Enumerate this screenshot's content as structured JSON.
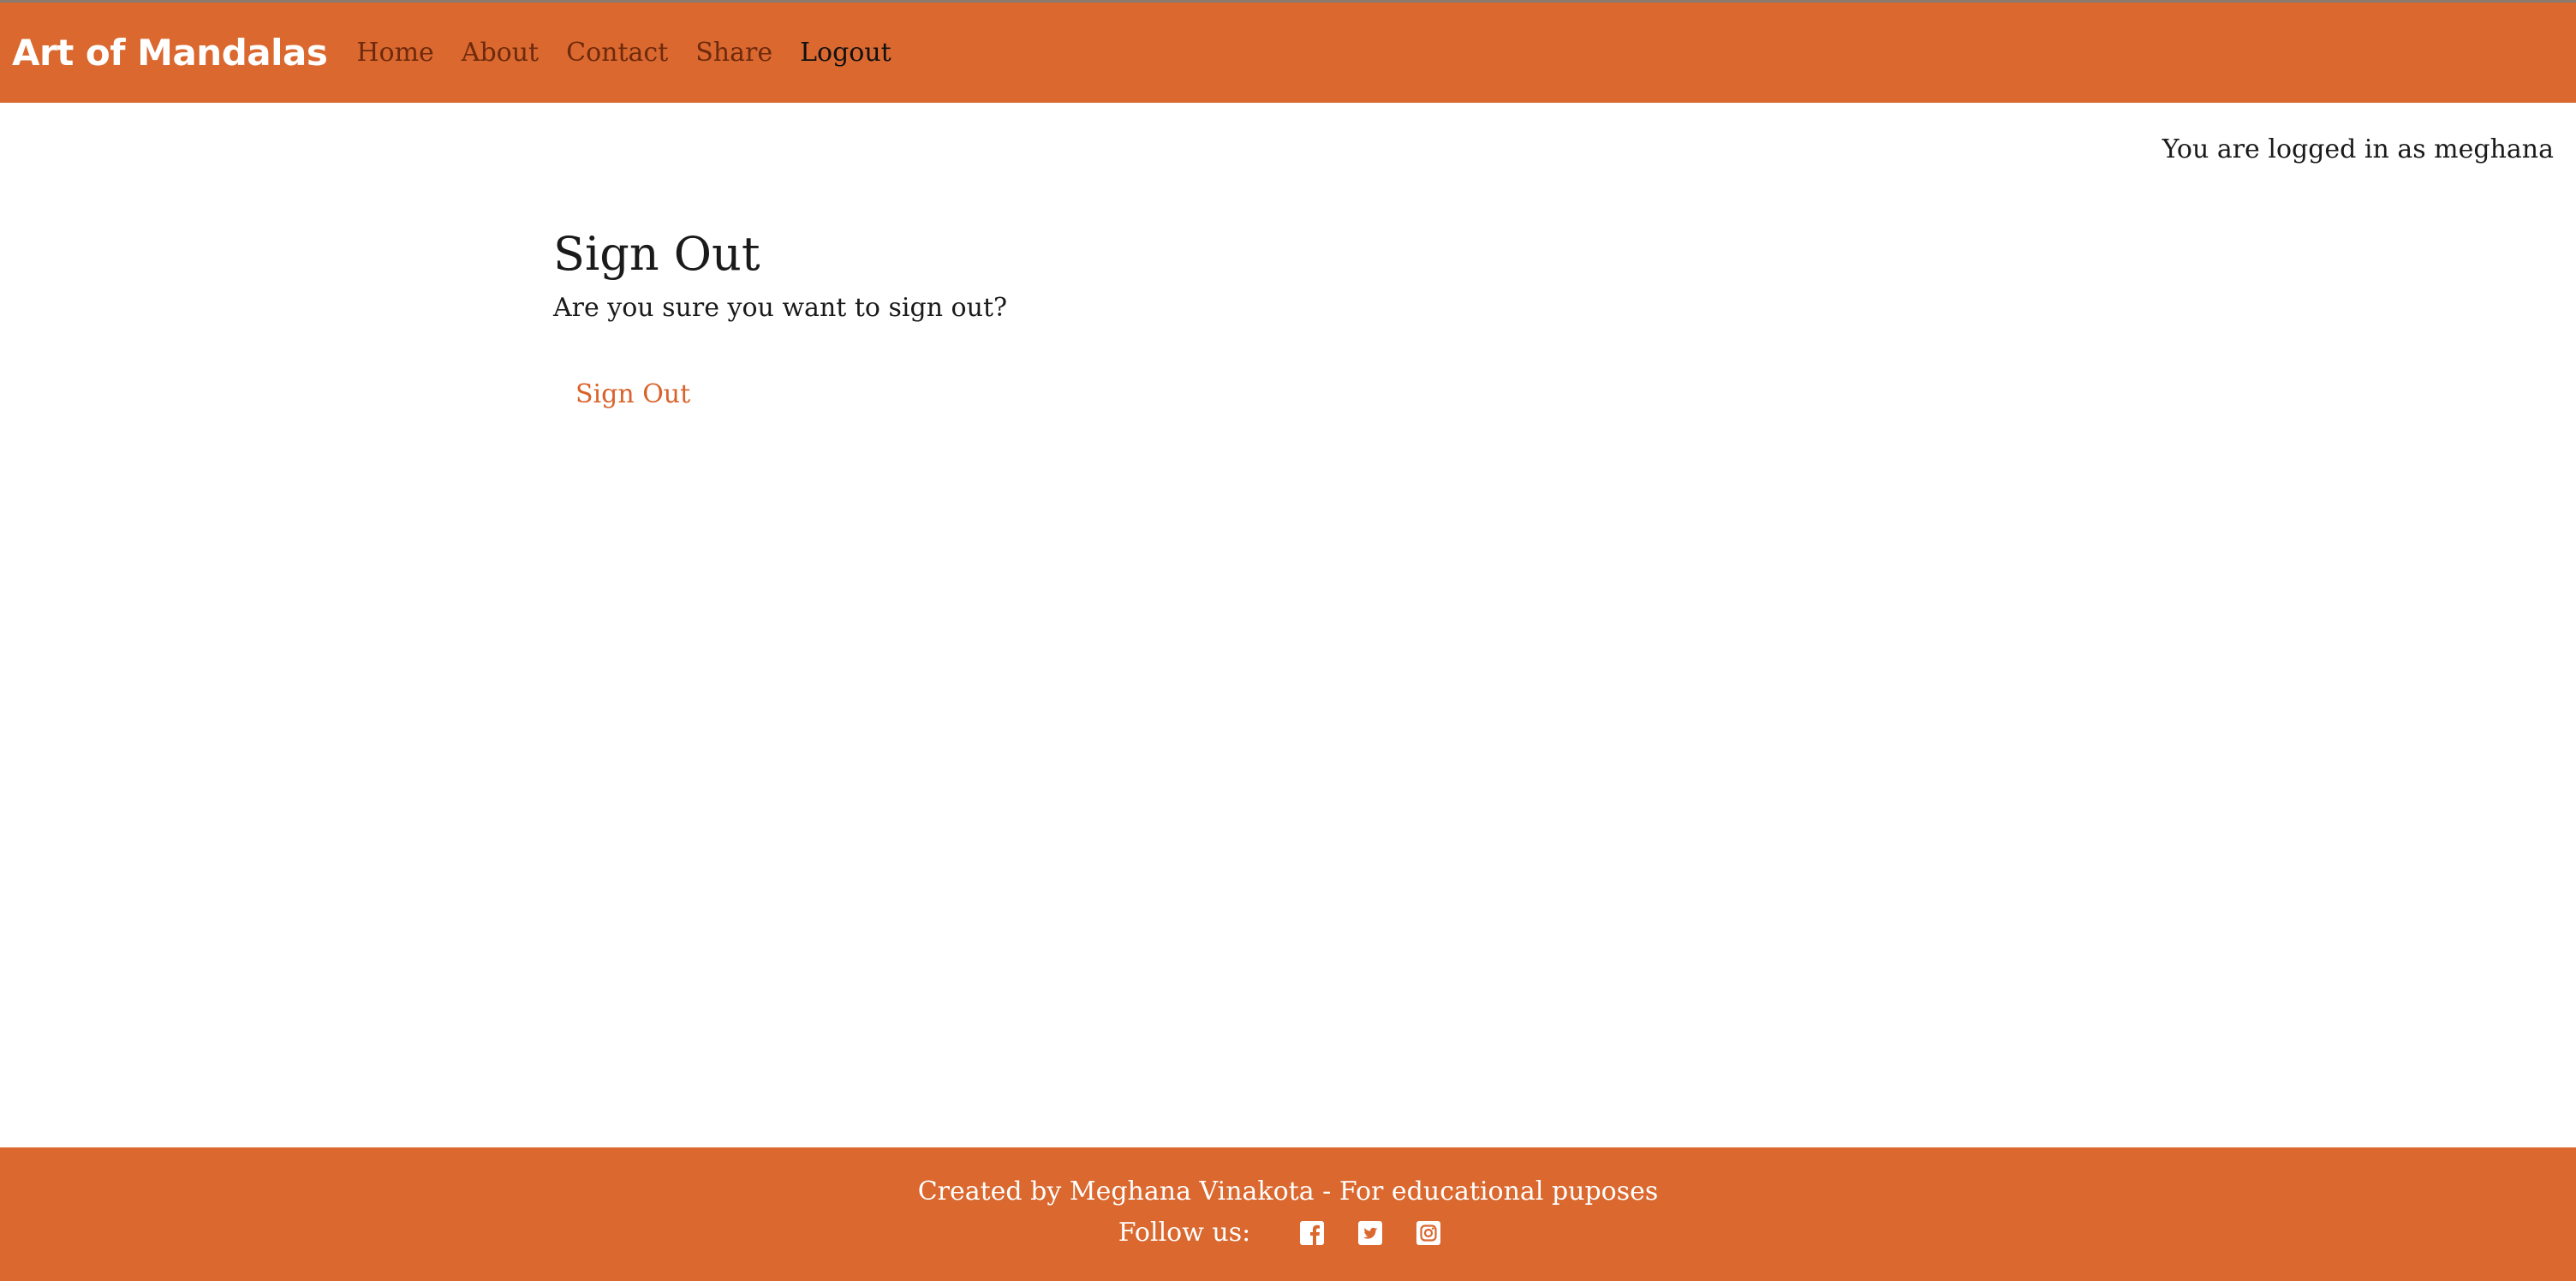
{
  "navbar": {
    "brand": "Art of Mandalas",
    "links": [
      {
        "label": "Home"
      },
      {
        "label": "About"
      },
      {
        "label": "Contact"
      },
      {
        "label": "Share"
      },
      {
        "label": "Logout"
      }
    ],
    "active": "Logout"
  },
  "status": {
    "logged_in_text": "You are logged in as meghana"
  },
  "main": {
    "title": "Sign Out",
    "prompt": "Are you sure you want to sign out?",
    "signout_button": "Sign Out"
  },
  "footer": {
    "credit": "Created by Meghana Vinakota - For educational puposes",
    "follow_label": "Follow us:",
    "social_icons": [
      "facebook-icon",
      "twitter-icon",
      "instagram-icon"
    ]
  },
  "colors": {
    "brand": "#da682f",
    "nav_link": "#6e2a0c",
    "accent_button": "#d9622a"
  }
}
